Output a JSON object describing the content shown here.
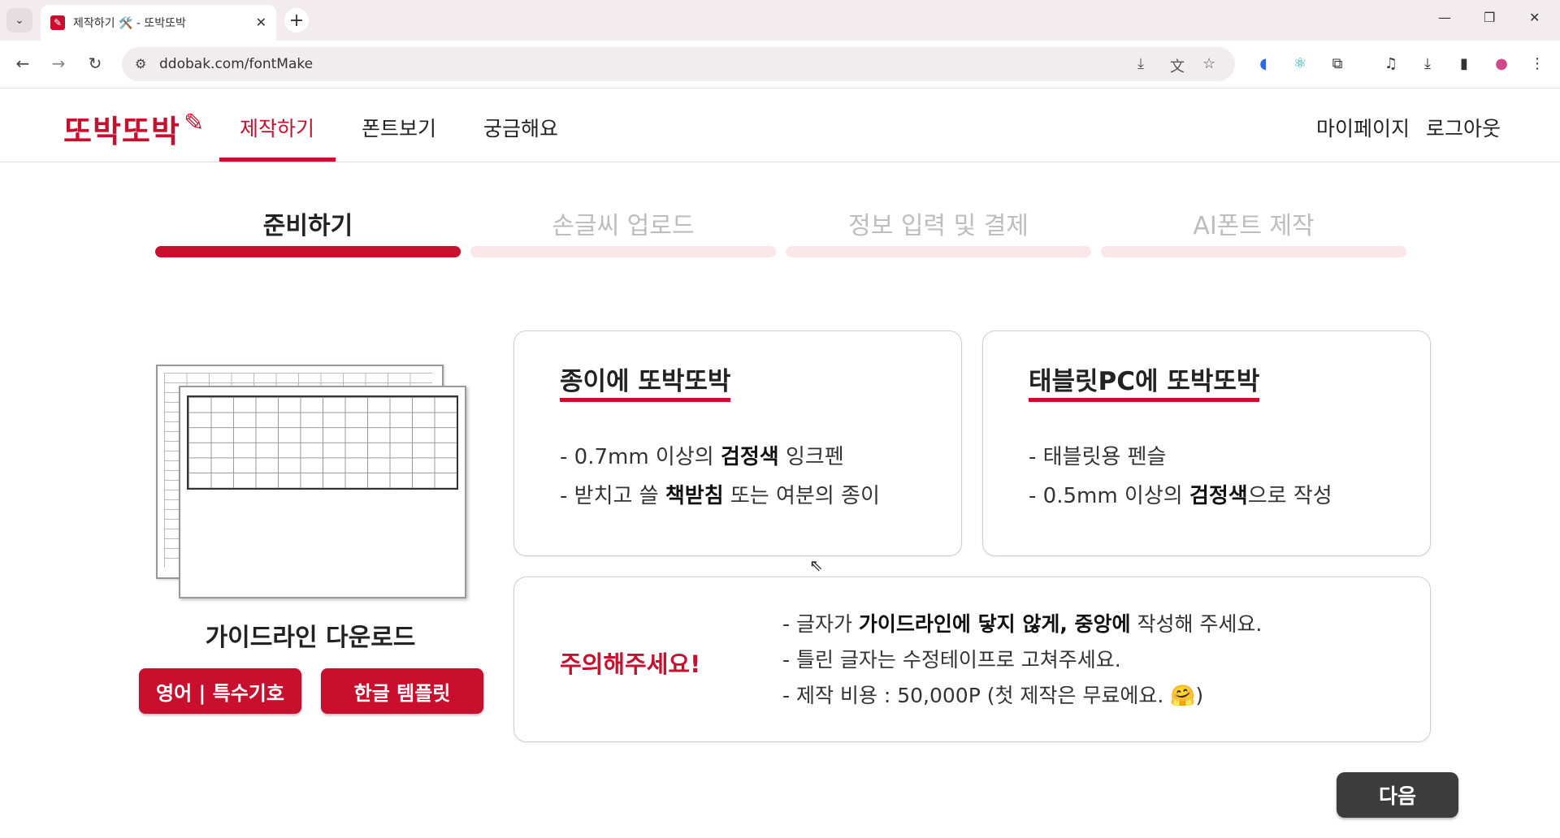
{
  "browser": {
    "tab_title": "제작하기 🛠️ - 또박또박",
    "tab_close": "✕",
    "url": "ddobak.com/fontMake",
    "tab_menu_icon": "chevron-down-icon",
    "new_tab_icon": "plus-icon"
  },
  "header": {
    "logo": "또박또박",
    "nav": [
      "제작하기",
      "폰트보기",
      "궁금해요"
    ],
    "active_nav": "제작하기",
    "mypage": "마이페이지",
    "logout": "로그아웃"
  },
  "steps": [
    {
      "label": "준비하기",
      "active": true
    },
    {
      "label": "손글씨 업로드",
      "active": false
    },
    {
      "label": "정보 입력 및 결제",
      "active": false
    },
    {
      "label": "AI폰트 제작",
      "active": false
    }
  ],
  "guideline": {
    "title": "가이드라인 다운로드",
    "buttons": [
      "영어 | 특수기호",
      "한글 템플릿"
    ]
  },
  "paper_card": {
    "title": "종이에 또박또박",
    "line1": {
      "pre": "- 0.7mm 이상의 ",
      "bold": "검정색",
      "post": " 잉크펜"
    },
    "line2": {
      "pre": "- 받치고 쓸 ",
      "bold": "책받침",
      "post": " 또는 여분의 종이"
    }
  },
  "tablet_card": {
    "title": "태블릿PC에 또박또박",
    "line1": "- 태블릿용 펜슬",
    "line2": {
      "pre": "- 0.5mm 이상의 ",
      "bold": "검정색",
      "post": "으로 작성"
    }
  },
  "notice": {
    "title": "주의해주세요!",
    "line1": {
      "pre": "- 글자가 ",
      "bold": "가이드라인에 닿지 않게, 중앙에",
      "post": " 작성해 주세요."
    },
    "line2": "- 틀린 글자는 수정테이프로 고쳐주세요.",
    "line3": "- 제작 비용 : 50,000P (첫 제작은 무료에요. 🤗)"
  },
  "next_button": "다음",
  "colors": {
    "brand": "#c8102e",
    "dark_button": "#3c3c3c",
    "inactive_step": "#fbe7ea"
  }
}
